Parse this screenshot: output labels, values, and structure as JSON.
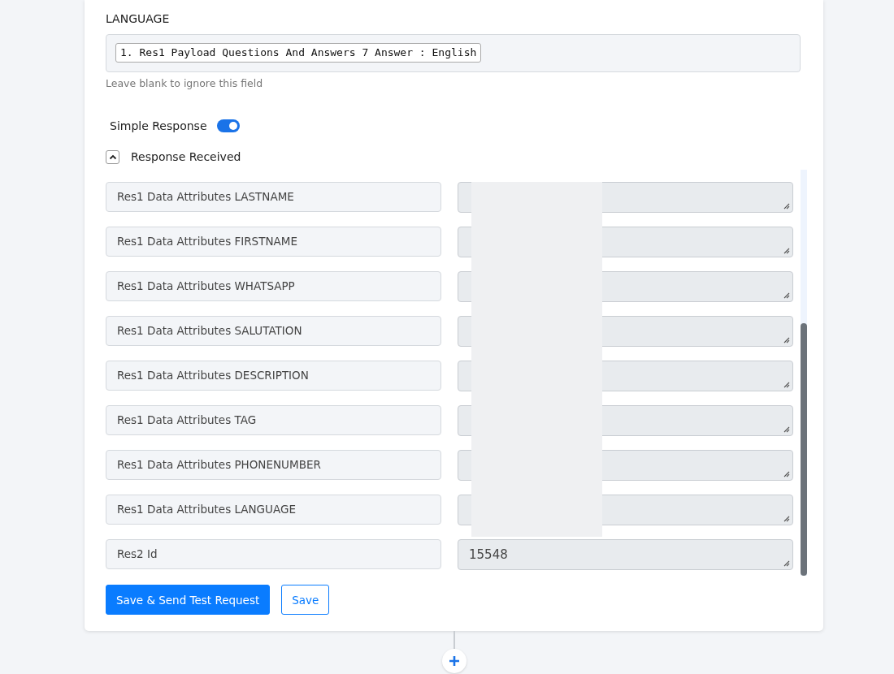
{
  "language": {
    "label": "LANGUAGE",
    "tokens": [
      "1. Res1 Payload Questions And Answers 7 Answer : English"
    ],
    "hint": "Leave blank to ignore this field"
  },
  "simple_response": {
    "label": "Simple Response",
    "on": true
  },
  "response_received": {
    "label": "Response Received",
    "expanded": true
  },
  "rows": [
    {
      "label": "Res1 Data Attributes LASTNAME"
    },
    {
      "label": "Res1 Data Attributes FIRSTNAME"
    },
    {
      "label": "Res1 Data Attributes WHATSAPP"
    },
    {
      "label": "Res1 Data Attributes SALUTATION"
    },
    {
      "label": "Res1 Data Attributes DESCRIPTION"
    },
    {
      "label": "Res1 Data Attributes TAG"
    },
    {
      "label": "Res1 Data Attributes PHONENUMBER"
    },
    {
      "label": "Res1 Data Attributes LANGUAGE"
    },
    {
      "label": "Res2 Id",
      "value": "15548"
    }
  ],
  "buttons": [
    {
      "label": "Save & Send Test Request",
      "kind": "primary"
    },
    {
      "label": "Save",
      "kind": "outline"
    }
  ]
}
